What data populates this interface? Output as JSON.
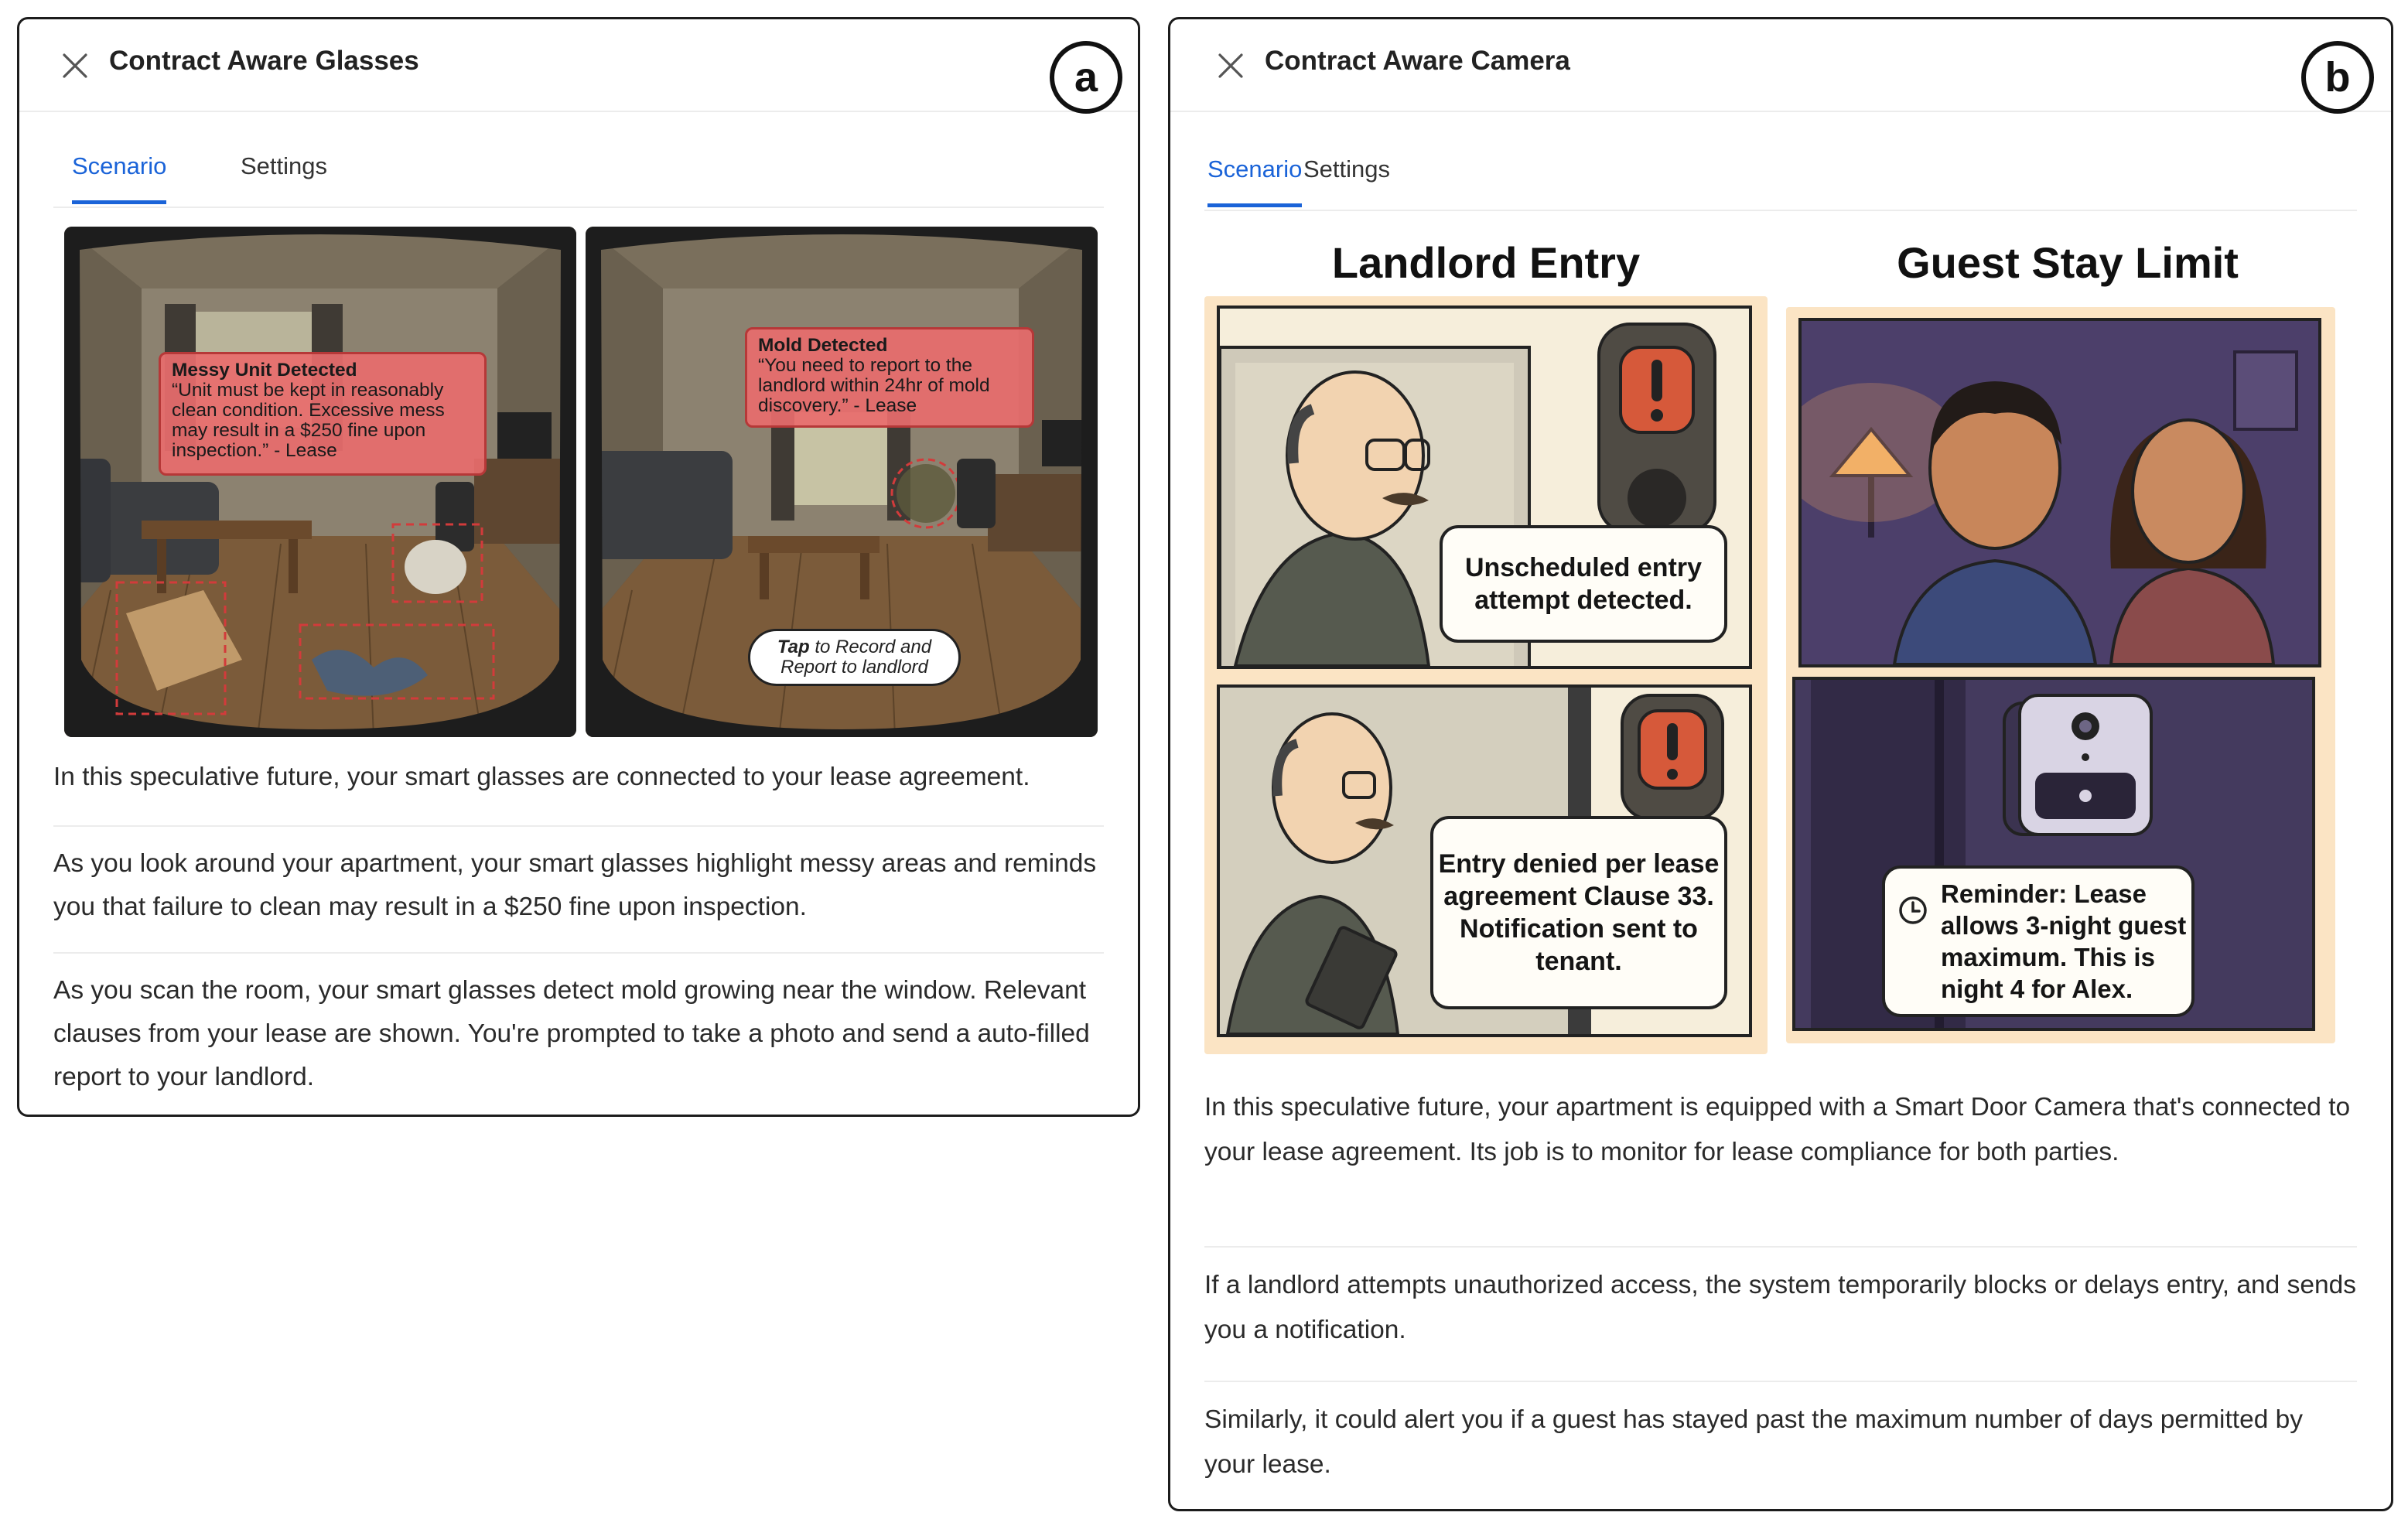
{
  "panel_a": {
    "title": "Contract Aware Glasses",
    "badge": "a",
    "tabs": [
      {
        "label": "Scenario",
        "active": true
      },
      {
        "label": "Settings",
        "active": false
      }
    ],
    "scene_left": {
      "callout_title": "Messy Unit Detected",
      "callout_body": "“Unit must be kept in reasonably clean condition. Excessive mess may result in a $250 fine upon inspection.” - Lease"
    },
    "scene_right": {
      "callout_title": "Mold Detected",
      "callout_body": "“You need to report to the landlord within 24hr of mold discovery.” - Lease",
      "tap_bold": "Tap",
      "tap_rest1": " to Record and",
      "tap_rest2": "Report to landlord"
    },
    "paragraphs": [
      "In this speculative future, your smart glasses are connected to your lease agreement.",
      "As you look around your apartment, your smart glasses highlight messy areas and reminds you that failure to clean may result in a $250 fine upon inspection.",
      "As you scan the room, your smart glasses detect mold growing near the window. Relevant clauses from your lease are shown. You're prompted to take a photo and send a auto-filled report to your landlord."
    ]
  },
  "panel_b": {
    "title": "Contract Aware Camera",
    "badge": "b",
    "tabs": [
      {
        "label": "Scenario",
        "active": true
      },
      {
        "label": "Settings",
        "active": false
      }
    ],
    "comic_left": {
      "heading": "Landlord Entry",
      "bubble_top": "Unscheduled entry attempt detected.",
      "bubble_bottom": "Entry denied per lease agreement Clause 33. Notification sent to tenant."
    },
    "comic_right": {
      "heading": "Guest Stay Limit",
      "bubble_bottom": "Reminder: Lease allows 3-night guest maximum. This is night 4 for Alex."
    },
    "paragraphs": [
      "In this speculative future, your apartment is equipped with a Smart Door Camera that's connected to your lease agreement. Its job is to monitor for lease compliance for both parties.",
      "If a landlord attempts unauthorized access, the system temporarily blocks or delays entry, and sends you a notification.",
      "Similarly, it could alert you if a guest has stayed past the maximum number of days permitted by your lease."
    ]
  },
  "colors": {
    "accent": "#1a63d8",
    "alert_red": "#e86c6c",
    "comic_bg": "#fbe4c4",
    "night_purple": "#4a3c66"
  }
}
